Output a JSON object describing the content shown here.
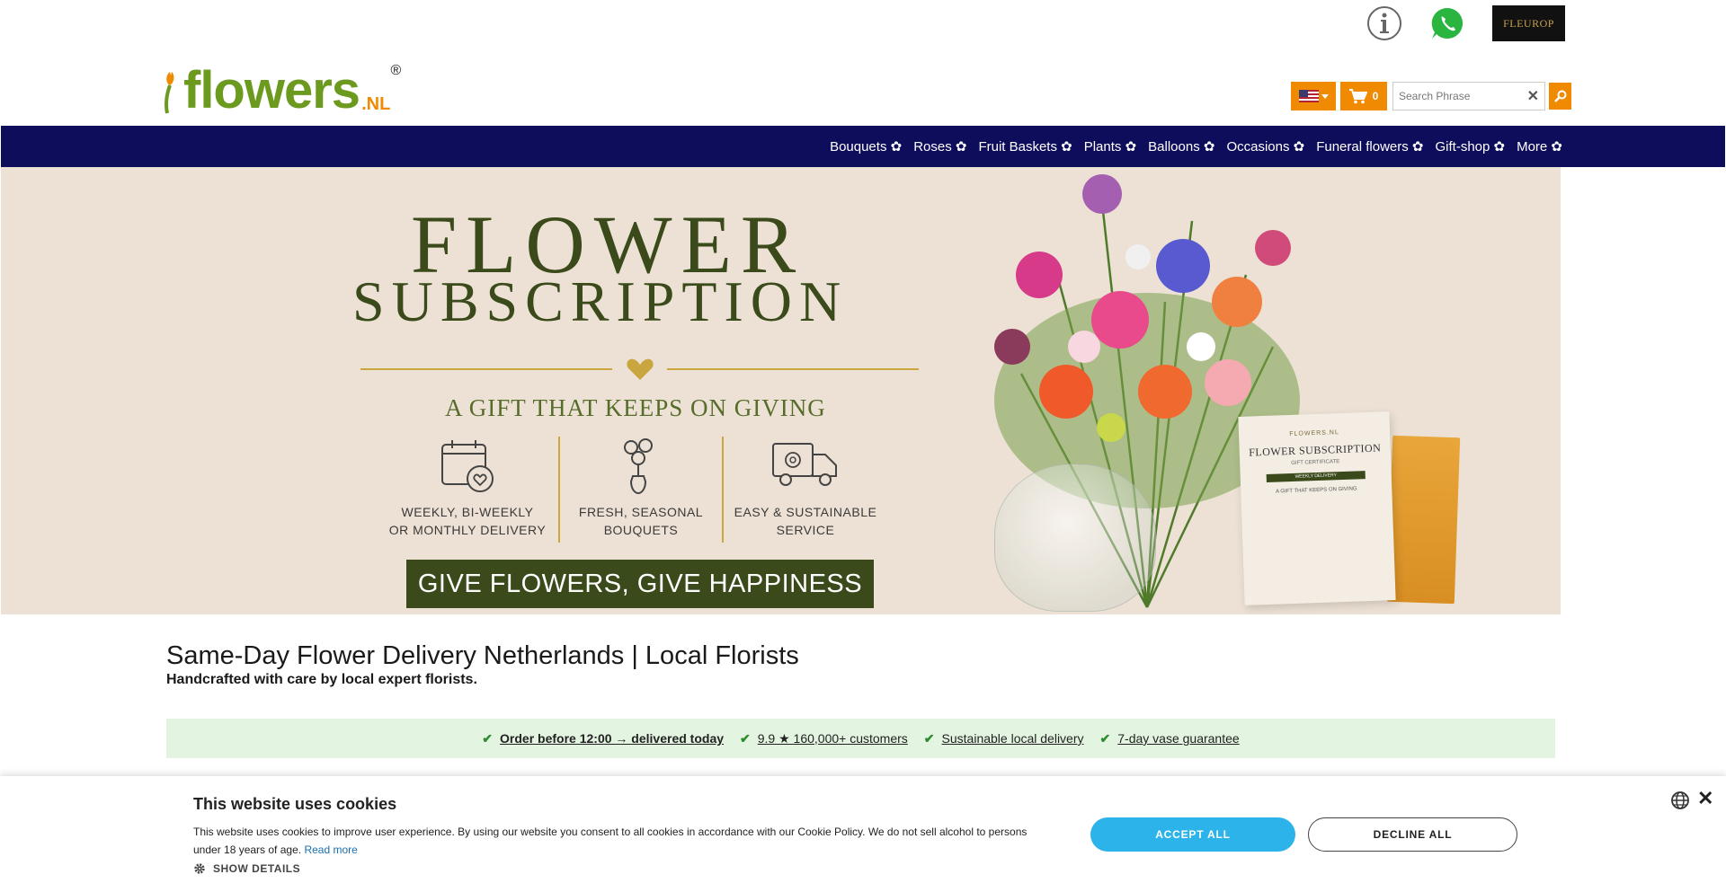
{
  "header": {
    "fleurop_label": "FLEUROP",
    "logo": {
      "text": "flowers",
      "suffix": ".NL",
      "reg": "®"
    },
    "cart_count": "0",
    "search": {
      "placeholder": "Search Phrase",
      "value": ""
    },
    "clear_symbol": "✕"
  },
  "nav": {
    "items": [
      {
        "label": "Bouquets ✿"
      },
      {
        "label": "Roses ✿"
      },
      {
        "label": "Fruit Baskets ✿"
      },
      {
        "label": "Plants ✿"
      },
      {
        "label": "Balloons ✿"
      },
      {
        "label": "Occasions ✿"
      },
      {
        "label": "Funeral flowers ✿"
      },
      {
        "label": "Gift-shop ✿"
      },
      {
        "label": "More ✿"
      }
    ]
  },
  "hero": {
    "title1": "FLOWER",
    "title2": "SUBSCRIPTION",
    "tagline": "A GIFT THAT KEEPS ON GIVING",
    "features": [
      {
        "line1": "WEEKLY, BI-WEEKLY",
        "line2": "OR MONTHLY DELIVERY"
      },
      {
        "line1": "FRESH, SEASONAL",
        "line2": "BOUQUETS"
      },
      {
        "line1": "EASY & SUSTAINABLE",
        "line2": "SERVICE"
      }
    ],
    "cta": "GIVE FLOWERS, GIVE HAPPINESS",
    "certificate": {
      "brand": "FLOWERS.NL",
      "title": "FLOWER SUBSCRIPTION",
      "subtitle": "GIFT CERTIFICATE",
      "band": "WEEKLY DELIVERY",
      "tag": "A GIFT THAT KEEPS ON GIVING"
    }
  },
  "content": {
    "title": "Same-Day Flower Delivery Netherlands | Local Florists",
    "subtitle": "Handcrafted with care by local expert florists.",
    "usps": [
      {
        "text": "Order before 12:00 → delivered today"
      },
      {
        "text": "9.9 ★ 160,000+ customers"
      },
      {
        "text": "Sustainable local delivery"
      },
      {
        "text": "7-day vase guarantee"
      }
    ],
    "tick": "✔"
  },
  "cookie": {
    "title": "This website uses cookies",
    "text": "This website uses cookies to improve user experience. By using our website you consent to all cookies in accordance with our Cookie Policy. We do not sell alcohol to persons under 18 years of age.",
    "read_more": "Read more",
    "show_details": "SHOW DETAILS",
    "accept": "ACCEPT ALL",
    "decline": "DECLINE ALL",
    "close_symbol": "✕"
  },
  "colors": {
    "brand_green": "#6b9a1e",
    "brand_orange": "#f08a00",
    "nav_bg": "#0d0d5c",
    "hero_bg": "#ece1d4",
    "hero_text": "#3b4a1a",
    "usp_bg": "#e3f5e1",
    "accept_bg": "#2bb3ea"
  }
}
